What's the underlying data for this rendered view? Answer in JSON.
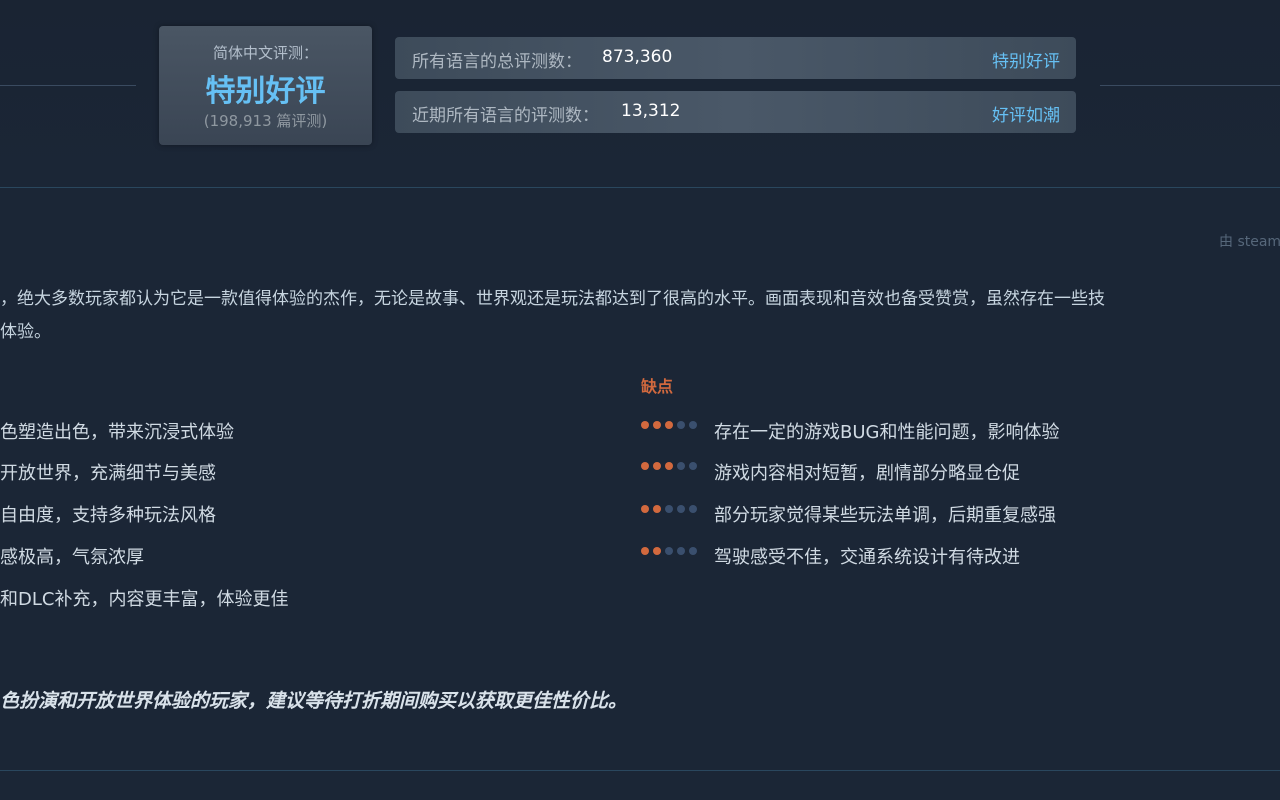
{
  "chinese_reviews": {
    "label": "简体中文评测：",
    "rating": "特别好评",
    "count": "(198,913 篇评测)"
  },
  "summary": {
    "all_label": "所有语言的总评测数：",
    "all_value": "873,360",
    "all_rating": "特别好评",
    "recent_label": "近期所有语言的评测数：",
    "recent_value": "13,312",
    "recent_rating": "好评如潮"
  },
  "ai_summary": {
    "attribution": "由 steam",
    "paragraph_line1": "，绝大多数玩家都认为它是一款值得体验的杰作，无论是故事、世界观还是玩法都达到了很高的水平。画面表现和音效也备受赞赏，虽然存在一些技",
    "paragraph_line2": "体验。"
  },
  "pros": [
    {
      "text": "色塑造出色，带来沉浸式体验"
    },
    {
      "text": "开放世界，充满细节与美感"
    },
    {
      "text": "自由度，支持多种玩法风格"
    },
    {
      "text": "感极高，气氛浓厚"
    },
    {
      "text": "和DLC补充，内容更丰富，体验更佳"
    }
  ],
  "cons": {
    "title": "缺点",
    "items": [
      {
        "text": "存在一定的游戏BUG和性能问题，影响体验",
        "severity": 3
      },
      {
        "text": "游戏内容相对短暂，剧情部分略显仓促",
        "severity": 3
      },
      {
        "text": "部分玩家觉得某些玩法单调，后期重复感强",
        "severity": 2
      },
      {
        "text": "驾驶感受不佳，交通系统设计有待改进",
        "severity": 2
      }
    ]
  },
  "verdict": "色扮演和开放世界体验的玩家，建议等待打折期间购买以获取更佳性价比。",
  "colors": {
    "accent_blue": "#66c0f4",
    "cons_orange": "#d2693e",
    "dot_inactive": "#3a4f6e"
  }
}
